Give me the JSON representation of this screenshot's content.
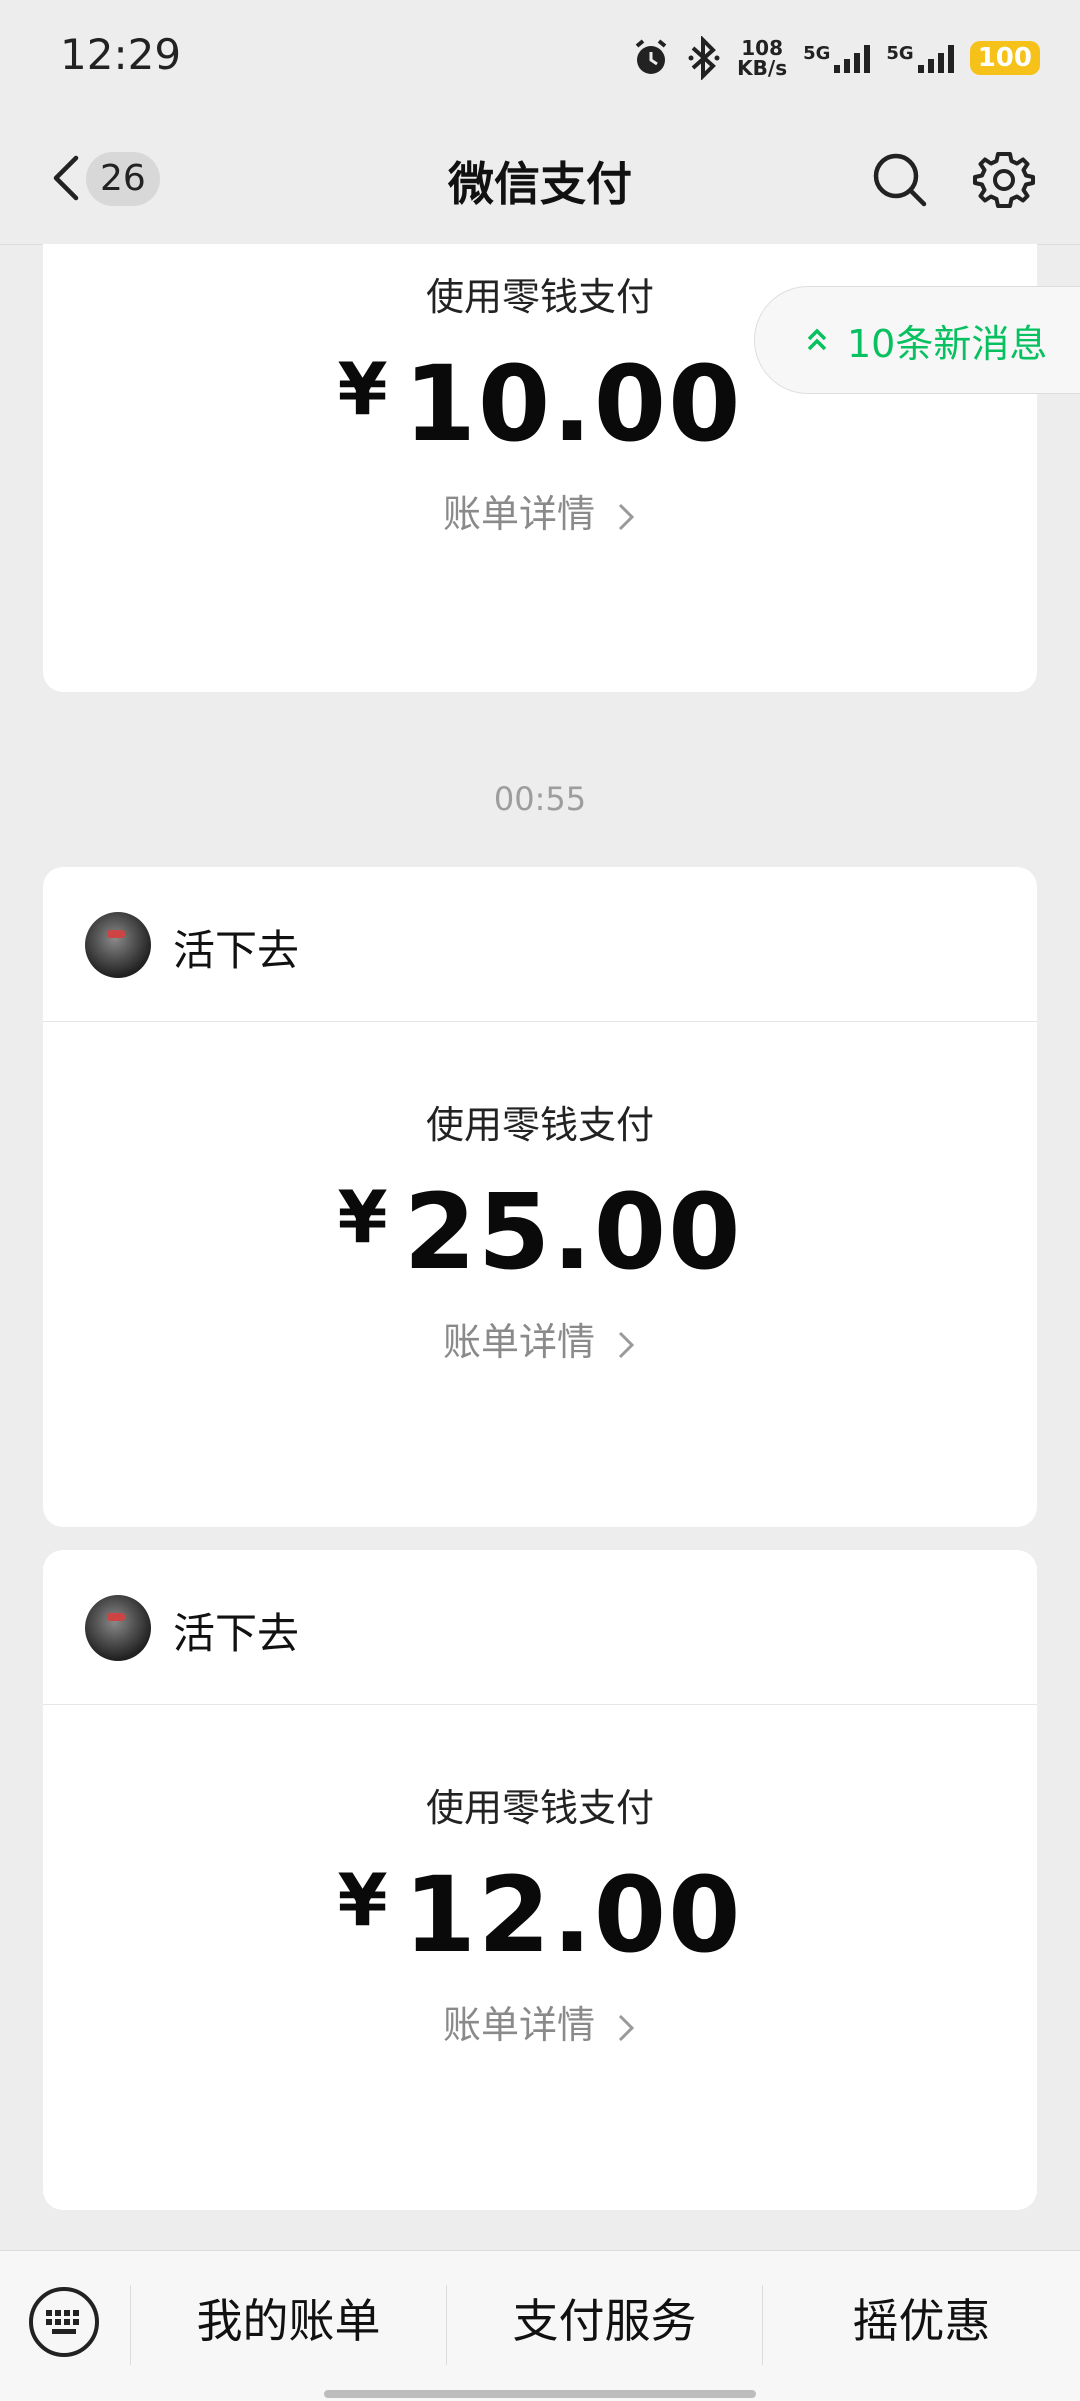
{
  "status_bar": {
    "time": "12:29",
    "speed_value": "108",
    "speed_unit": "KB/s",
    "sim1": "5G",
    "sim2": "5G",
    "battery": "100"
  },
  "nav": {
    "unread_count": "26",
    "title": "微信支付"
  },
  "new_messages": "10条新消息",
  "time_separator": "00:55",
  "cards": [
    {
      "pay_label": "使用零钱支付",
      "currency": "¥",
      "amount": "10.00",
      "detail": "账单详情"
    },
    {
      "name": "活下去",
      "pay_label": "使用零钱支付",
      "currency": "¥",
      "amount": "25.00",
      "detail": "账单详情"
    },
    {
      "name": "活下去",
      "pay_label": "使用零钱支付",
      "currency": "¥",
      "amount": "12.00",
      "detail": "账单详情"
    }
  ],
  "bottom_menu": [
    "我的账单",
    "支付服务",
    "摇优惠"
  ],
  "colors": {
    "accent": "#07c160",
    "battery": "#f6c21a",
    "background": "#ededed"
  },
  "icons": [
    "back-icon",
    "search-icon",
    "gear-icon",
    "double-chevron-up-icon",
    "chevron-right-icon",
    "keyboard-icon",
    "alarm-icon",
    "bluetooth-icon"
  ]
}
